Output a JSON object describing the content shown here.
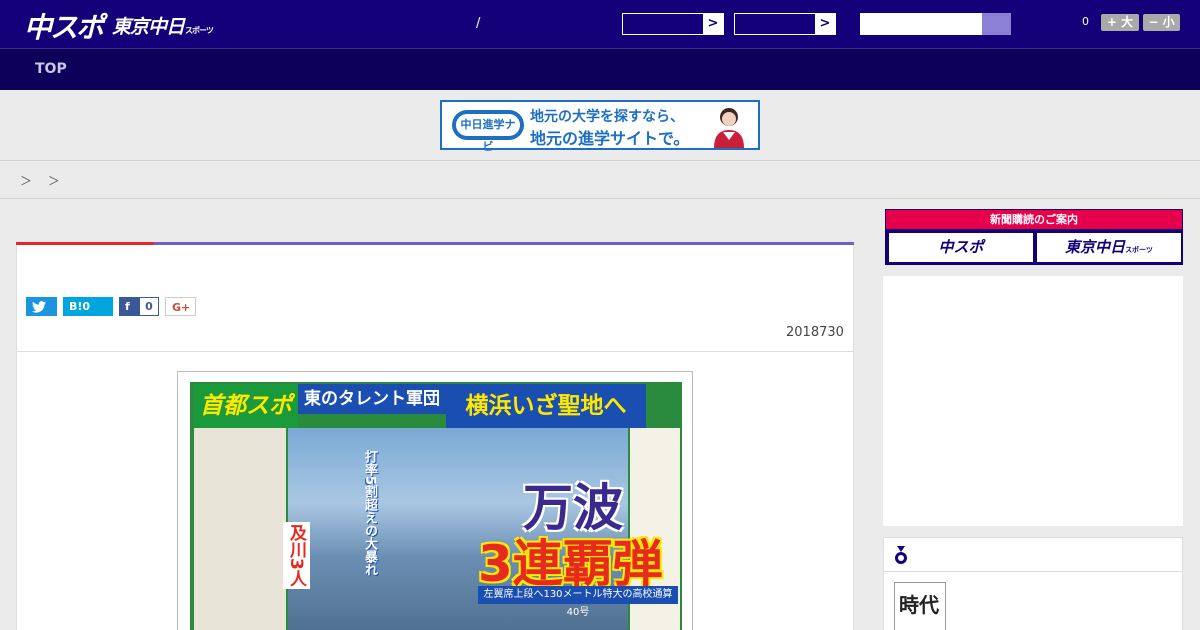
{
  "header": {
    "logo_main": "中スポ",
    "logo_secondary": "東京中日",
    "logo_secondary_small": "スポーツ",
    "separator": "/",
    "select_arrow": ">",
    "font_size_count": "0",
    "font_larger_label": "+ 大",
    "font_smaller_label": "− 小",
    "search_placeholder": ""
  },
  "nav": {
    "items": [
      {
        "label": "TOP"
      }
    ]
  },
  "banner": {
    "badge": "中日進学ナビ",
    "line1": "地元の大学を探すなら、",
    "line2": "地元の進学サイトで。"
  },
  "breadcrumb": {
    "text": "＞ ＞"
  },
  "article": {
    "date": "2018730",
    "share": {
      "twitter_label": "",
      "hatena_label": "B!0",
      "facebook_count": "0",
      "gplus_label": "G+"
    }
  },
  "newspaper": {
    "masthead": "首都スポ",
    "headline_small": "東のタレント軍団",
    "headline_main": "横浜いざ聖地へ",
    "big_name": "万波",
    "big_result": "3連覇弾",
    "caption": "左翼席上段へ130メートル特大の高校通算40号",
    "vertical_text": "打率5割超えの大暴れ",
    "side_name": "及川3人"
  },
  "sidebar": {
    "subscribe_heading": "新聞購読のご案内",
    "subscribe_chuspo": "中スポ",
    "subscribe_tokyo": "東京中日",
    "subscribe_tokyo_small": "スポーツ",
    "ranking_thumb_text": "時代"
  },
  "colors": {
    "header_bg": "#140078",
    "nav_bg": "#0c0058",
    "accent_red": "#e6252d",
    "accent_purple": "#7060c8",
    "subscribe_pink": "#e6004c"
  }
}
